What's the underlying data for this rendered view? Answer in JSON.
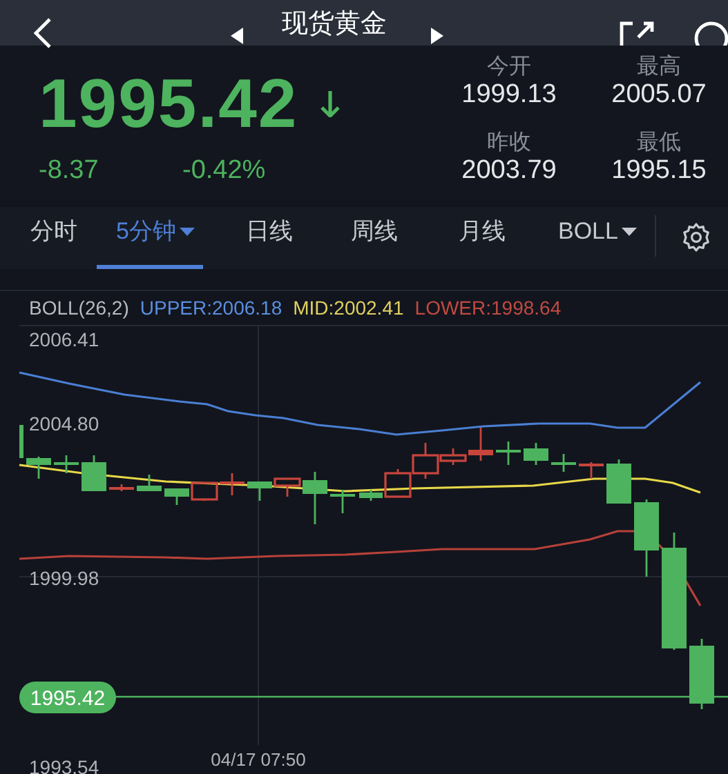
{
  "window": {
    "title": "现货黄金"
  },
  "quote": {
    "price": "1995.42",
    "change": "-8.37",
    "change_pct": "-0.42%",
    "falling": true
  },
  "stats": [
    {
      "label": "今开",
      "value": "1999.13"
    },
    {
      "label": "最高",
      "value": "2005.07"
    },
    {
      "label": "昨收",
      "value": "2003.79"
    },
    {
      "label": "最低",
      "value": "1995.15"
    }
  ],
  "tabs": [
    {
      "label": "分时",
      "selected": false,
      "kind": "plain"
    },
    {
      "label": "5分钟",
      "selected": true,
      "kind": "dropdown"
    },
    {
      "label": "日线",
      "selected": false,
      "kind": "plain"
    },
    {
      "label": "周线",
      "selected": false,
      "kind": "plain"
    },
    {
      "label": "月线",
      "selected": false,
      "kind": "plain"
    },
    {
      "label": "BOLL",
      "selected": false,
      "kind": "dropdown"
    }
  ],
  "legend": {
    "name": "BOLL(26,2)",
    "upper": "UPPER:2006.18",
    "mid": "MID:2002.41",
    "lower": "LOWER:1998.64"
  },
  "chart": {
    "y_labels": [
      "2006.41",
      "2004.80",
      "1999.98",
      "1993.54"
    ],
    "x_label": "04/17 07:50",
    "price_tag": "1995.42"
  }
}
